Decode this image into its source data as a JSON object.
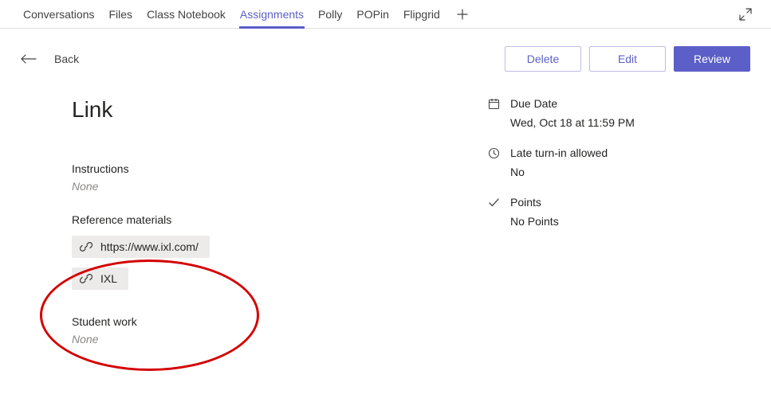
{
  "tabs": [
    {
      "label": "Conversations"
    },
    {
      "label": "Files"
    },
    {
      "label": "Class Notebook"
    },
    {
      "label": "Assignments"
    },
    {
      "label": "Polly"
    },
    {
      "label": "POPin"
    },
    {
      "label": "Flipgrid"
    }
  ],
  "back_label": "Back",
  "buttons": {
    "delete": "Delete",
    "edit": "Edit",
    "review": "Review"
  },
  "assignment": {
    "title": "Link",
    "instructions_label": "Instructions",
    "instructions_value": "None",
    "refmat_label": "Reference materials",
    "refs": [
      {
        "text": "https://www.ixl.com/"
      },
      {
        "text": "IXL"
      }
    ],
    "studentwork_label": "Student work",
    "studentwork_value": "None",
    "due_label": "Due Date",
    "due_value": "Wed, Oct 18 at 11:59 PM",
    "late_label": "Late turn-in allowed",
    "late_value": "No",
    "points_label": "Points",
    "points_value": "No Points"
  }
}
